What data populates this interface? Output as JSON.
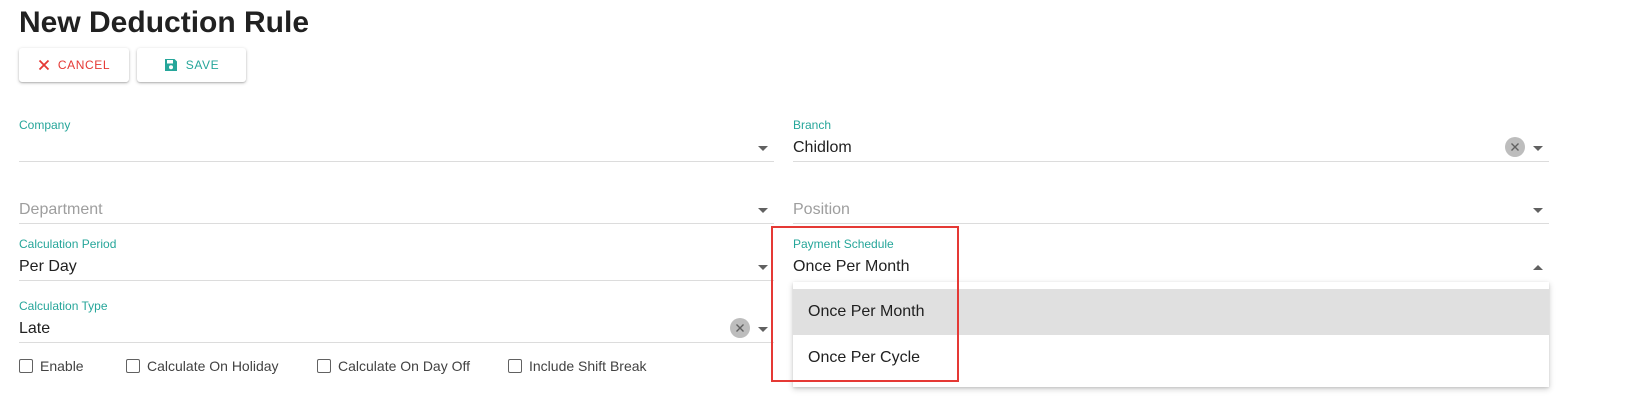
{
  "page": {
    "title": "New Deduction Rule"
  },
  "toolbar": {
    "cancel_label": "CANCEL",
    "save_label": "SAVE",
    "cancel_icon": "close-icon",
    "save_icon": "floppy-disk-icon"
  },
  "form": {
    "company": {
      "label": "Company",
      "value": ""
    },
    "branch": {
      "label": "Branch",
      "value": "Chidlom"
    },
    "department": {
      "placeholder": "Department"
    },
    "position": {
      "placeholder": "Position"
    },
    "calculation_period": {
      "label": "Calculation Period",
      "value": "Per Day"
    },
    "payment_schedule": {
      "label": "Payment Schedule",
      "value": "Once Per Month"
    },
    "calculation_type": {
      "label": "Calculation Type",
      "value": "Late"
    }
  },
  "checkboxes": [
    {
      "label": "Enable",
      "checked": false
    },
    {
      "label": "Calculate On Holiday",
      "checked": false
    },
    {
      "label": "Calculate On Day Off",
      "checked": false
    },
    {
      "label": "Include Shift Break",
      "checked": false
    }
  ],
  "dropdown": {
    "options": [
      {
        "label": "Once Per Month",
        "selected": true
      },
      {
        "label": "Once Per Cycle",
        "selected": false
      }
    ]
  },
  "colors": {
    "accent": "#26a69a",
    "danger": "#e53935",
    "highlight_border": "#e53935",
    "selected_option_bg": "#e0e0e0"
  }
}
